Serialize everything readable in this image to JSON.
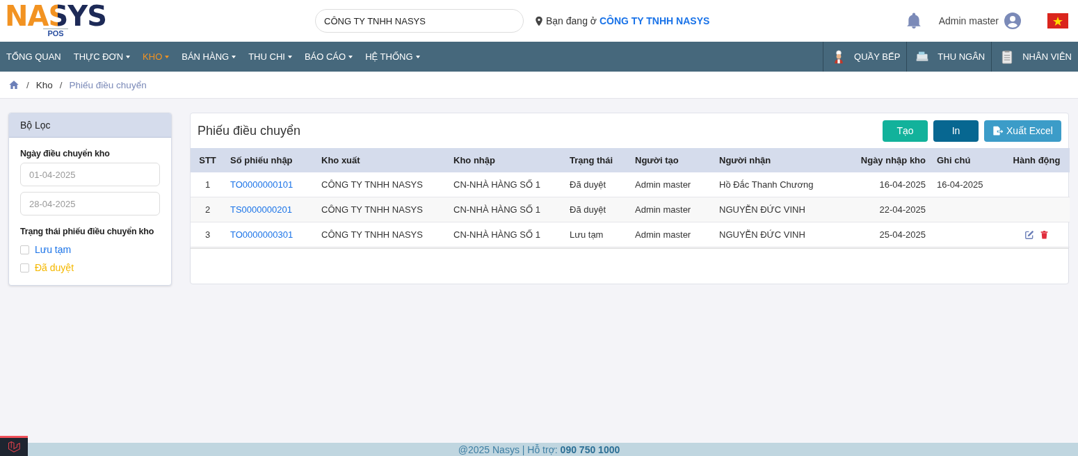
{
  "header": {
    "logo": {
      "text": "NASYS",
      "sub": "POS"
    },
    "company_field": {
      "value": "CÔNG TY TNHH NASYS"
    },
    "location": "Bạn đang ở **CÔNG TY TNHH NASYS**",
    "user": "Admin master"
  },
  "nav": {
    "items": [
      {
        "label": "TỔNG QUAN",
        "dropdown": false,
        "selected": false
      },
      {
        "label": "THỰC ĐƠN",
        "dropdown": true,
        "selected": false
      },
      {
        "label": "KHO",
        "dropdown": true,
        "selected": true
      },
      {
        "label": "BÁN HÀNG",
        "dropdown": true,
        "selected": false
      },
      {
        "label": "THU CHI",
        "dropdown": true,
        "selected": false
      },
      {
        "label": "BÁO CÁO",
        "dropdown": true,
        "selected": false
      },
      {
        "label": "HỆ THỐNG",
        "dropdown": true,
        "selected": false
      }
    ],
    "shortcuts": [
      {
        "kind": "chef",
        "label": "QUẦY BẾP"
      },
      {
        "kind": "cashier",
        "label": "THU NGÂN"
      },
      {
        "kind": "staff",
        "label": "NHÂN VIÊN"
      }
    ]
  },
  "breadcrumb": [
    {
      "separator": "/",
      "label": "Kho"
    },
    {
      "separator": "/",
      "label": "Phiếu điều chuyển"
    }
  ],
  "filter": {
    "title": "Bộ Lọc",
    "date_label": "Ngày điều chuyển kho",
    "date_from": {
      "placeholder": "01-04-2025"
    },
    "date_to": {
      "placeholder": "28-04-2025"
    },
    "status_label": "Trạng thái phiếu điều chuyển kho",
    "statuses": [
      {
        "label": "Lưu tạm",
        "checked": false,
        "color": "#1a73e8"
      },
      {
        "label": "Đã duyệt",
        "checked": false,
        "color": "#f5b800"
      }
    ]
  },
  "panel": {
    "title": "Phiếu điều chuyển",
    "buttons": [
      {
        "kind": "create",
        "label": "Tạo"
      },
      {
        "kind": "print",
        "label": "In"
      },
      {
        "kind": "export",
        "label": "Xuất Excel"
      }
    ]
  },
  "table": {
    "columns": [
      "STT",
      "Số phiếu nhập",
      "Kho xuất",
      "Kho nhập",
      "Trạng thái",
      "Người tạo",
      "Người nhận",
      "Ngày nhập kho",
      "Ghi chú",
      "Hành động"
    ],
    "rows": [
      {
        "stt": "1",
        "code": "TO0000000101",
        "from": "CÔNG TY TNHH NASYS",
        "to": "CN-NHÀ HÀNG SỐ 1",
        "status": "Đã duyệt",
        "creator": "Admin master",
        "receiver": "Hồ Đắc Thanh Chương",
        "date": "16-04-2025",
        "note": "16-04-2025",
        "actions": []
      },
      {
        "stt": "2",
        "code": "TS0000000201",
        "from": "CÔNG TY TNHH NASYS",
        "to": "CN-NHÀ HÀNG SỐ 1",
        "status": "Đã duyệt",
        "creator": "Admin master",
        "receiver": "NGUYỄN ĐỨC VINH",
        "date": "22-04-2025",
        "note": "",
        "actions": []
      },
      {
        "stt": "3",
        "code": "TO0000000301",
        "from": "CÔNG TY TNHH NASYS",
        "to": "CN-NHÀ HÀNG SỐ 1",
        "status": "Lưu tạm",
        "creator": "Admin master",
        "receiver": "NGUYỄN ĐỨC VINH",
        "date": "25-04-2025",
        "note": "",
        "actions": [
          {
            "kind": "edit"
          },
          {
            "kind": "delete"
          }
        ]
      }
    ]
  },
  "footer": "@2025 Nasys | Hỗ trợ: **090 750 1000**"
}
